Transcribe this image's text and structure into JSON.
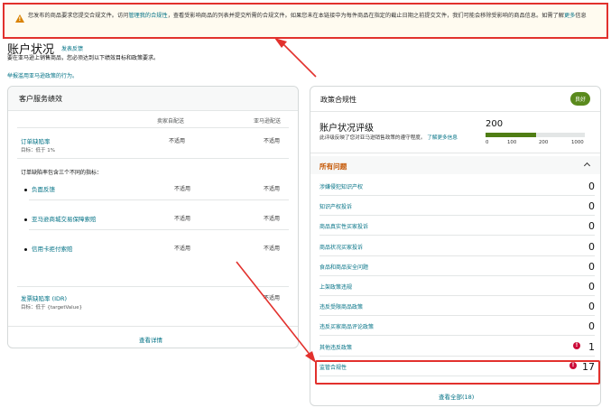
{
  "banner": {
    "text_a": "您发布的商品要求您提交合规文件。访问",
    "link": "管理我的合规性",
    "text_b": "，查看受影响商品的列表并提交所需的合规文件。如果您未在本链接中为每件商品在指定的截止日期之前提交文件，我们可能会移除受影响的商品信息。如需了解",
    "text_c": "更多",
    "text_d": "信息"
  },
  "page": {
    "title": "账户状况",
    "feedback_link": "发表反馈",
    "subtitle": "要在亚马逊上销售商品，您必须达到以下绩效目标和政策要求。",
    "report_link": "举报滥用亚马逊政策的行为。"
  },
  "customer_service": {
    "heading": "客户服务绩效",
    "col_seller": "卖家自配送",
    "col_amazon": "亚马逊配送",
    "odr_label": "订单缺陷率",
    "odr_target": "目标：低于 1%",
    "na": "不适用",
    "odr_intro": "订单缺陷率包含三个不同的指标：",
    "sub_metrics": [
      "负面反馈",
      "亚马逊商城交易保障索赔",
      "信用卡拒付索赔"
    ],
    "idr_label": "发票缺陷率 (IDR)",
    "idr_target": "目标：低于 {targetValue}",
    "view_details": "查看详情"
  },
  "policy": {
    "heading": "政策合规性",
    "badge": "良好",
    "ahr_title": "账户状况评级",
    "ahr_desc": "此评级反映了您对亚马逊销售政策的遵守程度。",
    "ahr_link": "了解更多信息",
    "ahr_score": "200",
    "ahr_ticks": [
      "0",
      "100",
      "200",
      "1000"
    ],
    "issues_heading": "所有问题",
    "issues": [
      {
        "name": "涉嫌侵犯知识产权",
        "count": "0",
        "alert": false
      },
      {
        "name": "知识产权投诉",
        "count": "0",
        "alert": false
      },
      {
        "name": "商品真实性买家投诉",
        "count": "0",
        "alert": false
      },
      {
        "name": "商品状况买家投诉",
        "count": "0",
        "alert": false
      },
      {
        "name": "食品和商品安全问题",
        "count": "0",
        "alert": false
      },
      {
        "name": "上架政策违规",
        "count": "0",
        "alert": false
      },
      {
        "name": "违反受限商品政策",
        "count": "0",
        "alert": false
      },
      {
        "name": "违反买家商品评论政策",
        "count": "0",
        "alert": false
      },
      {
        "name": "其他违反政策",
        "count": "1",
        "alert": true
      },
      {
        "name": "监管合规性",
        "count": "17",
        "alert": true
      }
    ],
    "view_all": "查看全部(18)"
  },
  "colors": {
    "accent": "#007185",
    "highlight": "#e2312d",
    "good": "#5a8a1d"
  }
}
